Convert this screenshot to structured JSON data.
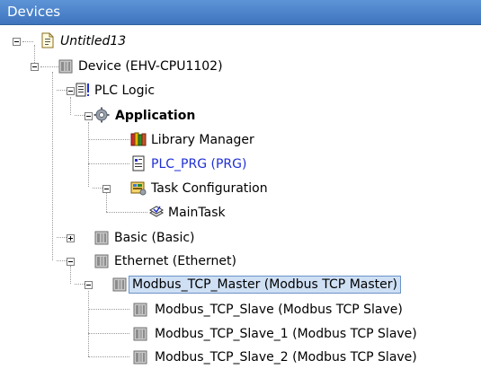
{
  "panel": {
    "title": "Devices"
  },
  "tree": {
    "root": {
      "label": "Untitled13",
      "icon": "project-icon",
      "expanded": true
    },
    "device": {
      "label": "Device (EHV-CPU1102)",
      "icon": "device-icon",
      "expanded": true
    },
    "plc_logic": {
      "label": "PLC Logic",
      "icon": "plc-logic-icon",
      "expanded": true
    },
    "application": {
      "label": "Application",
      "icon": "gear-icon",
      "expanded": true
    },
    "library_manager": {
      "label": "Library Manager",
      "icon": "library-books-icon"
    },
    "plc_prg": {
      "label": "PLC_PRG (PRG)",
      "icon": "program-icon",
      "color": "#1f2fd4"
    },
    "task_configuration": {
      "label": "Task Configuration",
      "icon": "task-config-icon",
      "expanded": true
    },
    "main_task": {
      "label": "MainTask",
      "icon": "task-icon"
    },
    "basic": {
      "label": "Basic (Basic)",
      "icon": "device-icon",
      "expanded": false
    },
    "ethernet": {
      "label": "Ethernet (Ethernet)",
      "icon": "device-icon",
      "expanded": true
    },
    "modbus_master": {
      "label": "Modbus_TCP_Master (Modbus TCP Master)",
      "icon": "device-icon",
      "expanded": true,
      "selected": true
    },
    "modbus_slave": {
      "label": "Modbus_TCP_Slave (Modbus TCP Slave)",
      "icon": "device-icon"
    },
    "modbus_slave_1": {
      "label": "Modbus_TCP_Slave_1 (Modbus TCP Slave)",
      "icon": "device-icon"
    },
    "modbus_slave_2": {
      "label": "Modbus_TCP_Slave_2 (Modbus TCP Slave)",
      "icon": "device-icon"
    }
  },
  "colors": {
    "title_bar": "#4f86cc",
    "selection_bg": "#cfe0f5",
    "selection_border": "#6b93c8",
    "link_blue": "#1f2fd4"
  }
}
